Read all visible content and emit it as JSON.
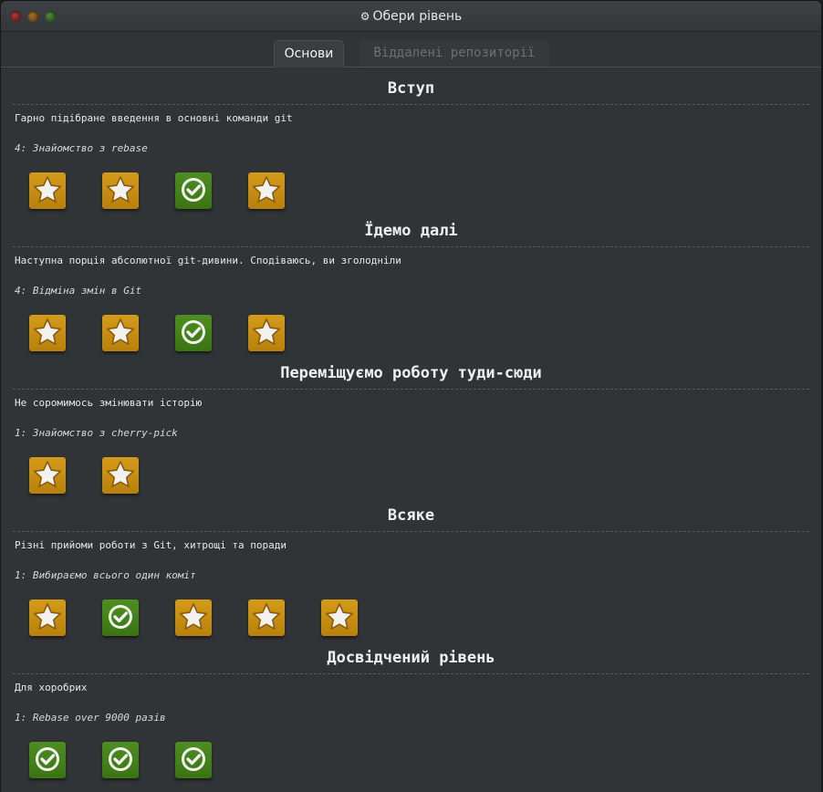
{
  "window": {
    "title": "Обери рівень",
    "title_icon": "gear-icon"
  },
  "tabs": [
    {
      "label": "Основи",
      "active": true
    },
    {
      "label": "Віддалені репозиторії",
      "active": false
    }
  ],
  "sequences": [
    {
      "title": "Вступ",
      "about": "Гарно підібране введення в основні команди git",
      "current_level": "4: Знайомство з rebase",
      "levels": [
        "star",
        "star",
        "check",
        "star"
      ]
    },
    {
      "title": "Їдемо далі",
      "about": "Наступна порція абсолютної git-дивини. Сподіваюсь, ви зголодніли",
      "current_level": "4: Відміна змін в Git",
      "levels": [
        "star",
        "star",
        "check",
        "star"
      ]
    },
    {
      "title": "Переміщуємо роботу туди-сюди",
      "about": "Не соромимось змінювати історію",
      "current_level": "1: Знайомство з cherry-pick",
      "levels": [
        "star",
        "star"
      ]
    },
    {
      "title": "Всяке",
      "about": "Різні прийоми роботи з Git, хитрощі та поради",
      "current_level": "1: Вибираємо всього один коміт",
      "levels": [
        "star",
        "check",
        "star",
        "star",
        "star"
      ]
    },
    {
      "title": "Досвідчений рівень",
      "about": "Для хоробрих",
      "current_level": "1: Rebase over 9000 разів",
      "levels": [
        "check",
        "check",
        "check"
      ]
    }
  ],
  "colors": {
    "star_tile": "#c88e12",
    "check_tile": "#448119",
    "background": "#303437"
  }
}
